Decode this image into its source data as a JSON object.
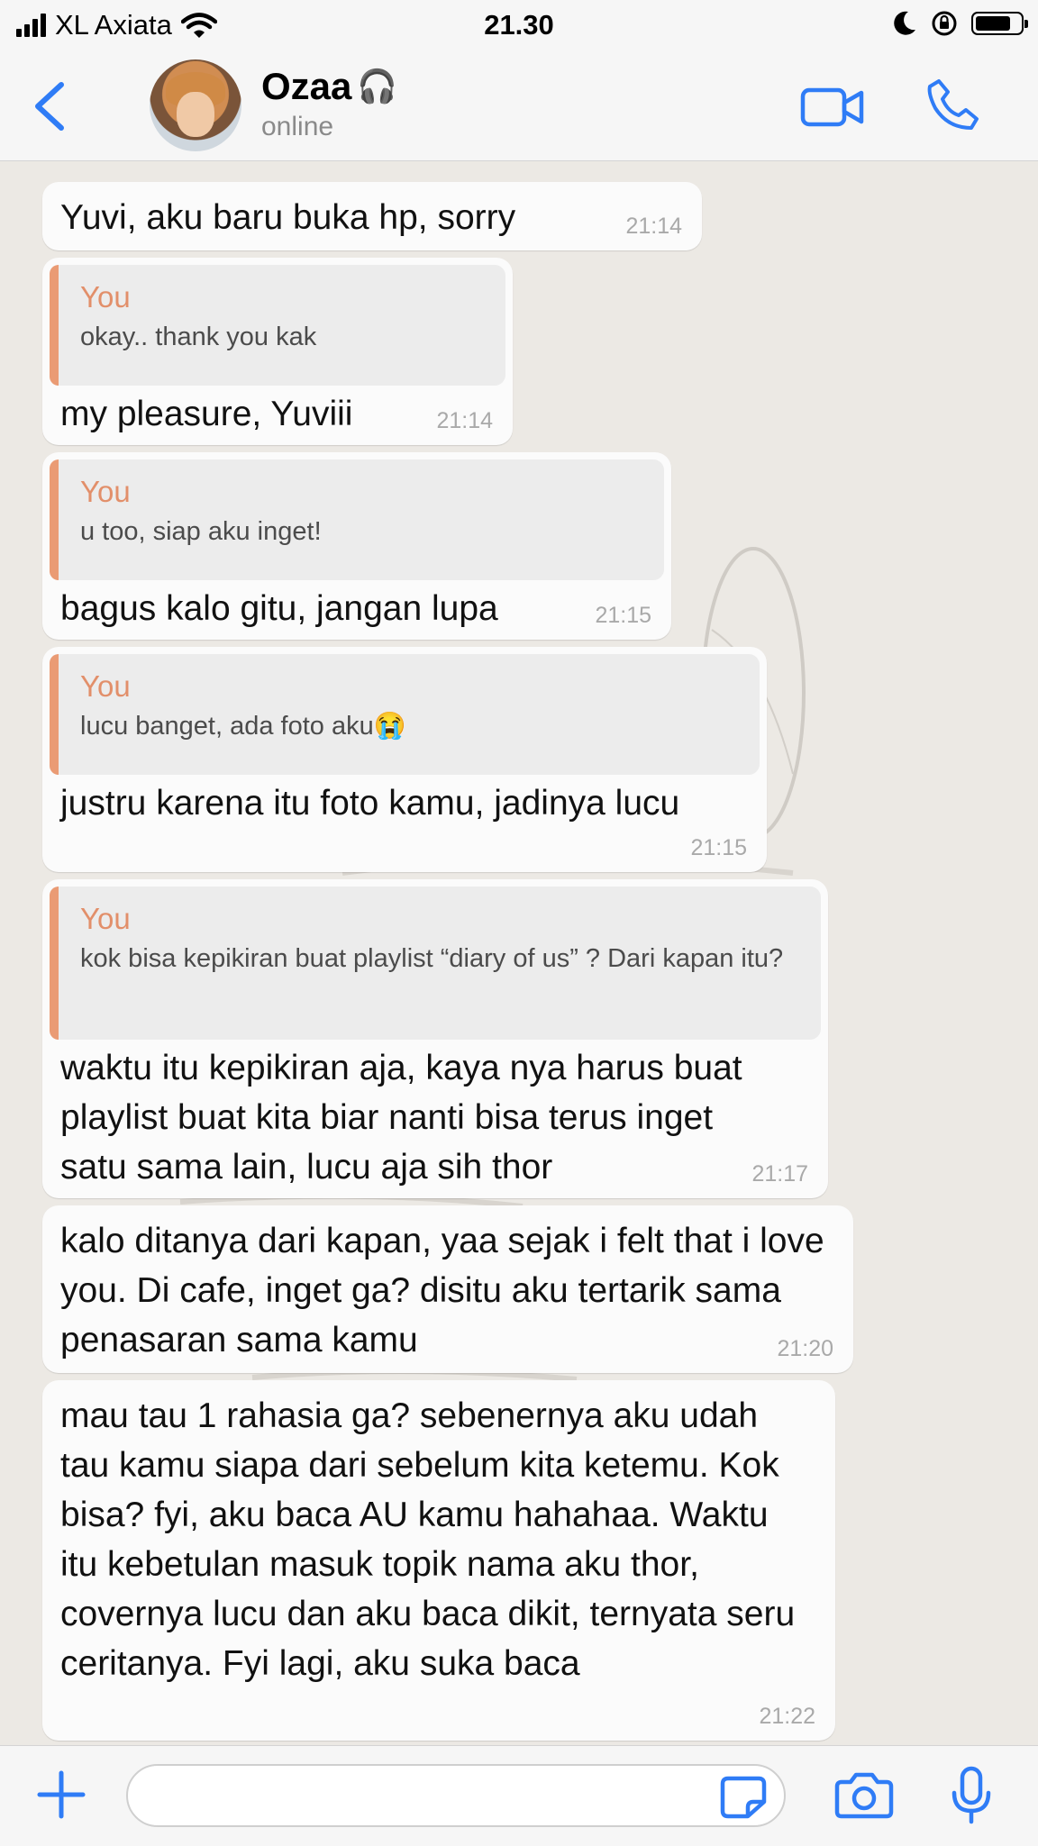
{
  "status_bar": {
    "carrier": "XL Axiata",
    "time": "21.30",
    "battery_level": 0.7
  },
  "header": {
    "contact_name": "Ozaa",
    "name_emoji": "🎧",
    "status": "online",
    "accent_color": "#2f7cf6"
  },
  "messages": [
    {
      "text": "Yuvi, aku baru buka hp, sorry",
      "time": "21:14"
    },
    {
      "quote_author": "You",
      "quote_text": "okay.. thank you kak",
      "text": "my pleasure, Yuviii",
      "time": "21:14"
    },
    {
      "quote_author": "You",
      "quote_text": "u too, siap aku inget!",
      "text": "bagus kalo gitu, jangan lupa",
      "time": "21:15"
    },
    {
      "quote_author": "You",
      "quote_text": "lucu banget, ada foto aku😭",
      "text": "justru karena itu foto kamu, jadinya lucu",
      "time": "21:15"
    },
    {
      "quote_author": "You",
      "quote_text": "kok bisa kepikiran buat playlist “diary of us” ? Dari kapan itu?",
      "text": "waktu itu kepikiran aja, kaya nya harus buat playlist buat kita biar nanti bisa terus inget satu sama lain, lucu aja sih thor",
      "time": "21:17"
    },
    {
      "text": "kalo ditanya dari kapan, yaa sejak i felt that i love you. Di cafe, inget ga? disitu aku tertarik sama penasaran sama kamu",
      "time": "21:20"
    },
    {
      "text": "mau tau 1 rahasia ga? sebenernya aku udah tau kamu siapa dari sebelum kita ketemu. Kok bisa? fyi, aku baca AU kamu hahahaa. Waktu itu kebetulan masuk topik nama aku thor, covernya lucu dan aku baca dikit, ternyata seru ceritanya. Fyi lagi, aku suka baca",
      "time": "21:22"
    }
  ],
  "input_bar": {
    "placeholder": ""
  }
}
